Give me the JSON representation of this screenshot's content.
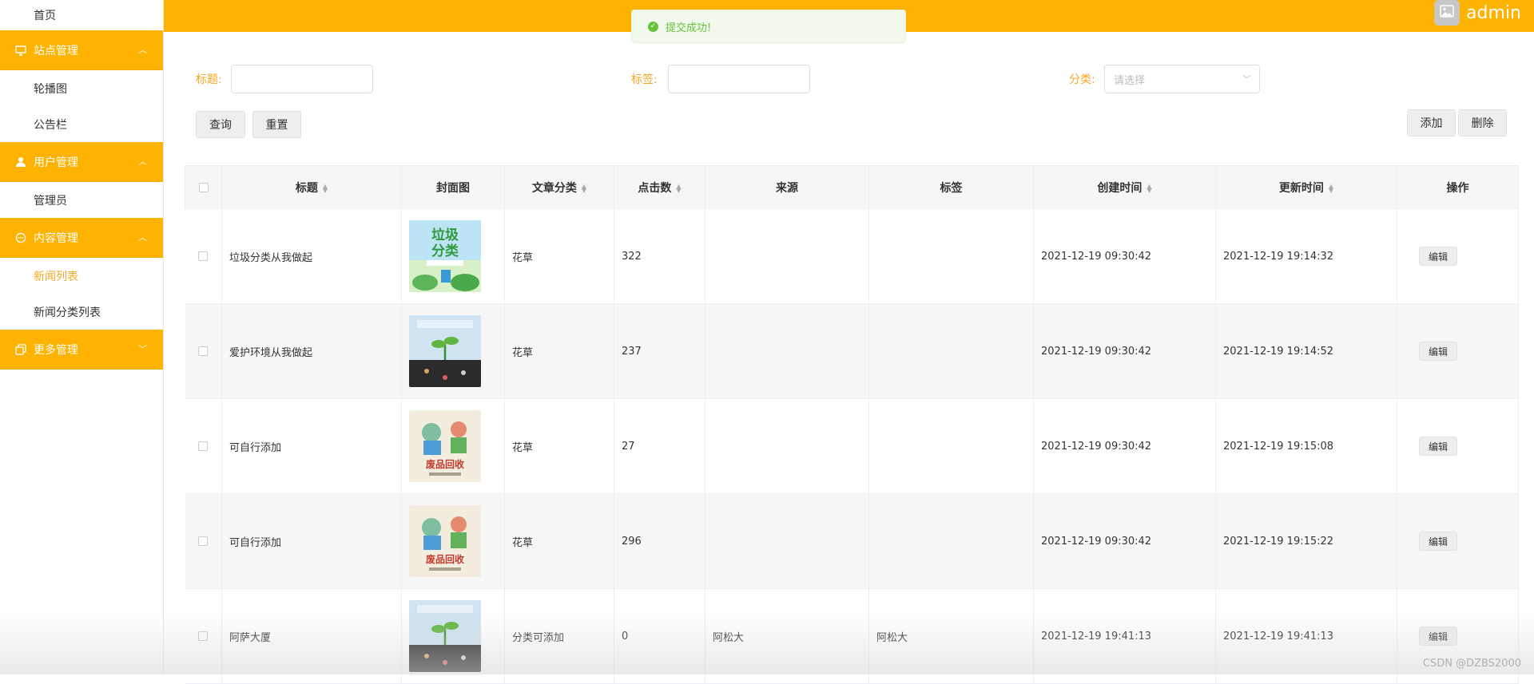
{
  "sidebar": {
    "home": "首页",
    "groups": [
      {
        "label": "站点管理",
        "icon": "monitor-icon",
        "chevron": "up",
        "items": [
          "轮播图",
          "公告栏"
        ]
      },
      {
        "label": "用户管理",
        "icon": "user-icon",
        "chevron": "up",
        "items": [
          "管理员"
        ]
      },
      {
        "label": "内容管理",
        "icon": "chat-icon",
        "chevron": "up",
        "items": [
          "新闻列表",
          "新闻分类列表"
        ],
        "active_item": "新闻列表"
      },
      {
        "label": "更多管理",
        "icon": "copy-icon",
        "chevron": "down",
        "items": []
      }
    ]
  },
  "header": {
    "username": "admin",
    "avatar_icon": "image-icon"
  },
  "toast": {
    "message": "提交成功!",
    "icon": "check-circle-icon"
  },
  "search": {
    "title_label": "标题:",
    "title_value": "",
    "tag_label": "标签:",
    "tag_value": "",
    "category_label": "分类:",
    "category_placeholder": "请选择",
    "query_button": "查询",
    "reset_button": "重置",
    "add_button": "添加",
    "delete_button": "删除"
  },
  "table": {
    "columns": [
      "标题",
      "封面图",
      "文章分类",
      "点击数",
      "来源",
      "标签",
      "创建时间",
      "更新时间",
      "操作"
    ],
    "sortable": [
      "标题",
      "文章分类",
      "点击数",
      "创建时间",
      "更新时间"
    ],
    "rows": [
      {
        "title": "垃圾分类从我做起",
        "cover": "garbage-sorting-poster",
        "category": "花草",
        "clicks": "322",
        "source": "",
        "tag": "",
        "created": "2021-12-19 09:30:42",
        "updated": "2021-12-19 19:14:32",
        "action": "编辑"
      },
      {
        "title": "爱护环境从我做起",
        "cover": "sprout-poster",
        "category": "花草",
        "clicks": "237",
        "source": "",
        "tag": "",
        "created": "2021-12-19 09:30:42",
        "updated": "2021-12-19 19:14:52",
        "action": "编辑"
      },
      {
        "title": "可自行添加",
        "cover": "recycling-poster",
        "category": "花草",
        "clicks": "27",
        "source": "",
        "tag": "",
        "created": "2021-12-19 09:30:42",
        "updated": "2021-12-19 19:15:08",
        "action": "编辑"
      },
      {
        "title": "可自行添加",
        "cover": "recycling-poster",
        "category": "花草",
        "clicks": "296",
        "source": "",
        "tag": "",
        "created": "2021-12-19 09:30:42",
        "updated": "2021-12-19 19:15:22",
        "action": "编辑"
      },
      {
        "title": "阿萨大厦",
        "cover": "sprout-poster",
        "category": "分类可添加",
        "clicks": "0",
        "source": "阿松大",
        "tag": "阿松大",
        "created": "2021-12-19 19:41:13",
        "updated": "2021-12-19 19:41:13",
        "action": "编辑"
      }
    ]
  },
  "watermark": "CSDN @DZBS2000",
  "colors": {
    "accent": "#fdb300",
    "label": "#f5a623",
    "success": "#67c23a"
  }
}
